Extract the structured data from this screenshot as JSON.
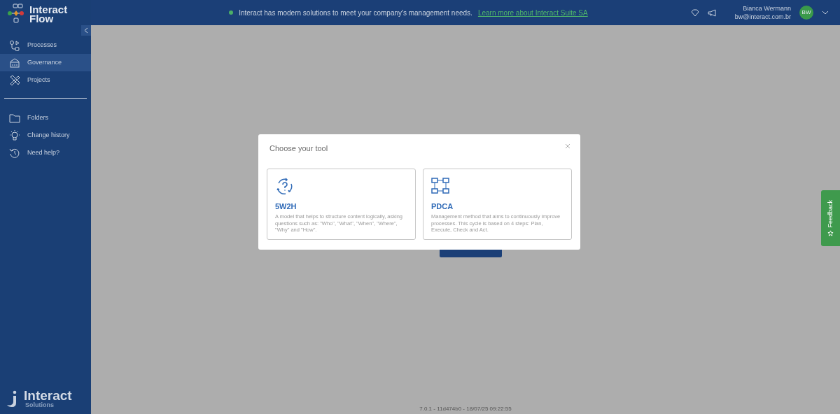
{
  "logo": {
    "line_1": "Interact",
    "line_2": "Flow"
  },
  "banner": {
    "message": "Interact has modern solutions to meet your company's management needs.",
    "link": "Learn more about Interact Suite SA"
  },
  "user": {
    "name": "Bianca Wermann",
    "email": "bw@interact.com.br",
    "initials": "BW"
  },
  "sidebar": {
    "items": [
      {
        "label": "Processes",
        "selected": false
      },
      {
        "label": "Governance",
        "selected": true
      },
      {
        "label": "Projects",
        "selected": false
      }
    ],
    "secondary_items": [
      {
        "label": "Folders"
      },
      {
        "label": "Change history"
      },
      {
        "label": "Need help?"
      }
    ]
  },
  "company_logo": {
    "name": "Interact",
    "tagline": "Solutions"
  },
  "modal": {
    "title": "Choose your tool",
    "options": [
      {
        "kind": "cycle",
        "title": "5W2H",
        "description": "A model that helps to structure content logically, asking questions such as: \"Who\", \"What\", \"When\", \"Where\", \"Why\" and \"How\"."
      },
      {
        "kind": "flowchart",
        "title": "PDCA",
        "description": "Management method that aims to continuously improve processes. This cycle is based on 4 steps: Plan, Execute, Check and Act."
      }
    ]
  },
  "feedback_tab": {
    "label": "Feedback"
  },
  "version": "7.0.1 - 11d474b0 - 18/07/25 09:22:55"
}
